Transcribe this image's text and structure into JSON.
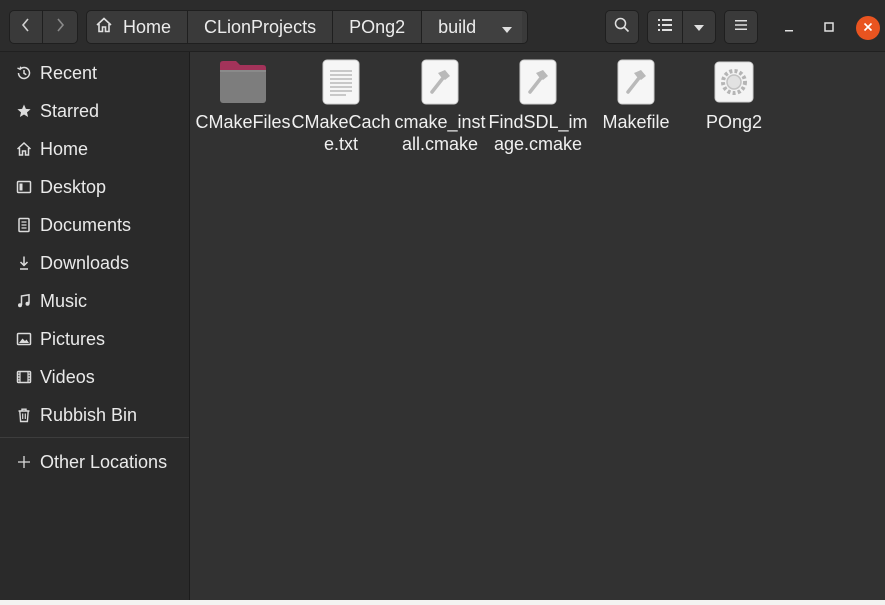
{
  "breadcrumbs": [
    "Home",
    "CLionProjects",
    "POng2",
    "build"
  ],
  "sidebar": {
    "items": [
      {
        "label": "Recent",
        "icon": "clock-icon"
      },
      {
        "label": "Starred",
        "icon": "star-icon"
      },
      {
        "label": "Home",
        "icon": "home-icon"
      },
      {
        "label": "Desktop",
        "icon": "desktop-icon"
      },
      {
        "label": "Documents",
        "icon": "document-icon"
      },
      {
        "label": "Downloads",
        "icon": "download-icon"
      },
      {
        "label": "Music",
        "icon": "music-icon"
      },
      {
        "label": "Pictures",
        "icon": "picture-icon"
      },
      {
        "label": "Videos",
        "icon": "video-icon"
      },
      {
        "label": "Rubbish Bin",
        "icon": "trash-icon"
      }
    ],
    "other_locations": "Other Locations"
  },
  "files": [
    {
      "name": "CMakeFiles",
      "type": "folder"
    },
    {
      "name": "CMakeCache.txt",
      "type": "text"
    },
    {
      "name": "cmake_install.cmake",
      "type": "script"
    },
    {
      "name": "FindSDL_image.cmake",
      "type": "script"
    },
    {
      "name": "Makefile",
      "type": "script"
    },
    {
      "name": "POng2",
      "type": "executable"
    }
  ],
  "colors": {
    "accent": "#e95420",
    "folder": "#7d7d7d",
    "folder_tab": "#a3335a"
  }
}
